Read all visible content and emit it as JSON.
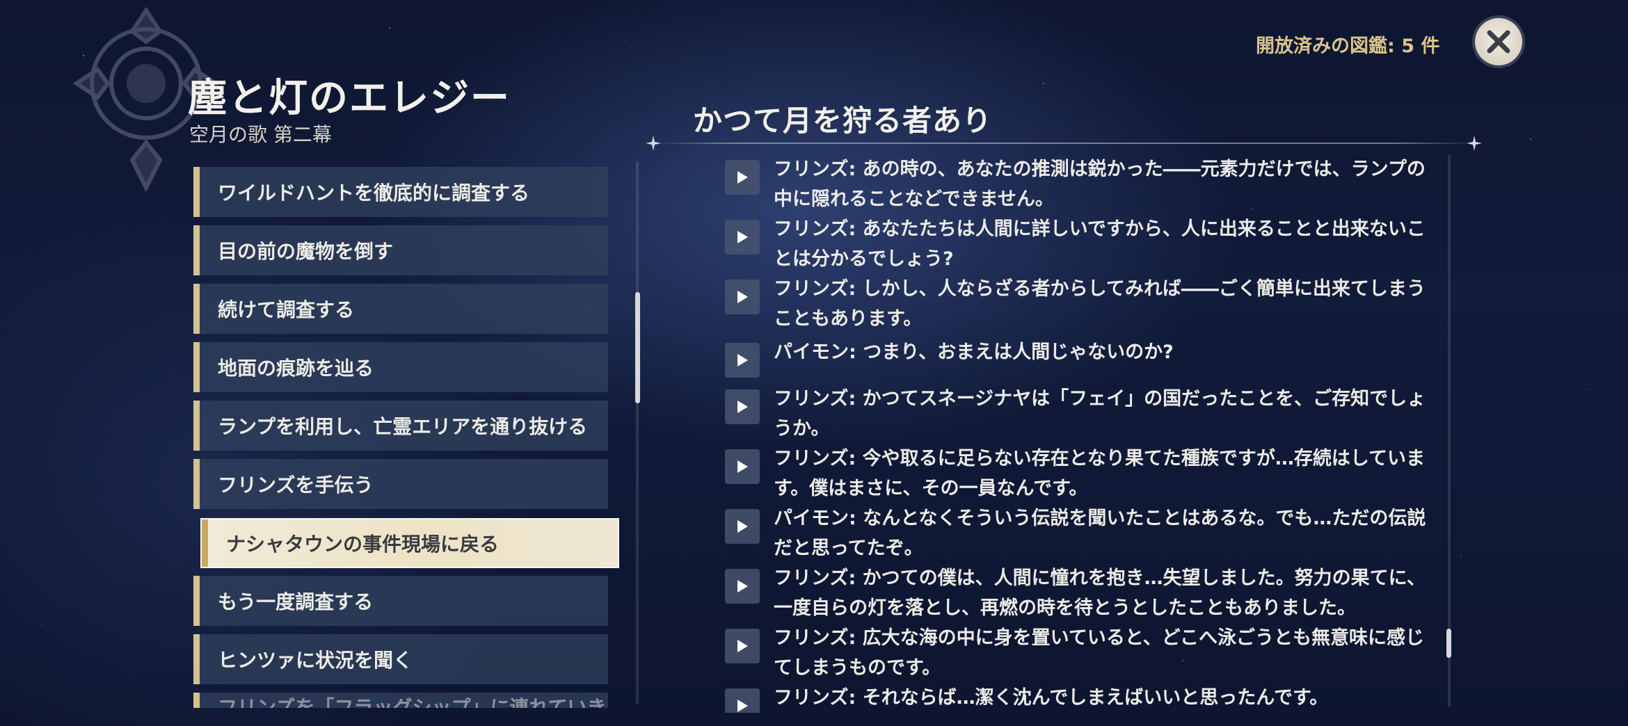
{
  "header": {
    "quest_title": "塵と灯のエレジー",
    "quest_subtitle": "空月の歌 第二幕",
    "unlocked_label": "開放済みの図鑑: 5 件",
    "close_icon": "close-icon"
  },
  "steps": [
    {
      "label": "ワイルドハントを徹底的に調査する"
    },
    {
      "label": "目の前の魔物を倒す"
    },
    {
      "label": "続けて調査する"
    },
    {
      "label": "地面の痕跡を辿る"
    },
    {
      "label": "ランプを利用し、亡霊エリアを通り抜ける"
    },
    {
      "label": "フリンズを手伝う"
    },
    {
      "label": "ナシャタウンの事件現場に戻る",
      "selected": true
    },
    {
      "label": "もう一度調査する"
    },
    {
      "label": "ヒンツァに状況を聞く"
    },
    {
      "label": "フリンズを「フラッグシップ」に連れていき、休ま"
    }
  ],
  "dialogue": {
    "title": "かつて月を狩る者あり",
    "lines": [
      {
        "text": "フリンズ: あの時の、あなたの推測は鋭かった――元素力だけでは、ランプの中に隠れることなどできません。"
      },
      {
        "text": "フリンズ: あなたたちは人間に詳しいですから、人に出来ることと出来ないことは分かるでしょう?"
      },
      {
        "text": "フリンズ: しかし、人ならざる者からしてみれば――ごく簡単に出来てしまうこともあります。"
      },
      {
        "text": "パイモン: つまり、おまえは人間じゃないのか?"
      },
      {
        "text": "フリンズ: かつてスネージナヤは「フェイ」の国だったことを、ご存知でしょうか。"
      },
      {
        "text": "フリンズ: 今や取るに足らない存在となり果てた種族ですが…存続はしています。僕はまさに、その一員なんです。"
      },
      {
        "text": "パイモン: なんとなくそういう伝説を聞いたことはあるな。でも…ただの伝説だと思ってたぞ。"
      },
      {
        "text": "フリンズ: かつての僕は、人間に憧れを抱き…失望しました。努力の果てに、一度自らの灯を落とし、再燃の時を待とうとしたこともありました。"
      },
      {
        "text": "フリンズ: 広大な海の中に身を置いていると、どこへ泳ごうとも無意味に感じてしまうものです。"
      },
      {
        "text": "フリンズ: それならば…潔く沈んでしまえばいいと思ったんです。"
      }
    ],
    "play_icon": "play-icon"
  }
}
